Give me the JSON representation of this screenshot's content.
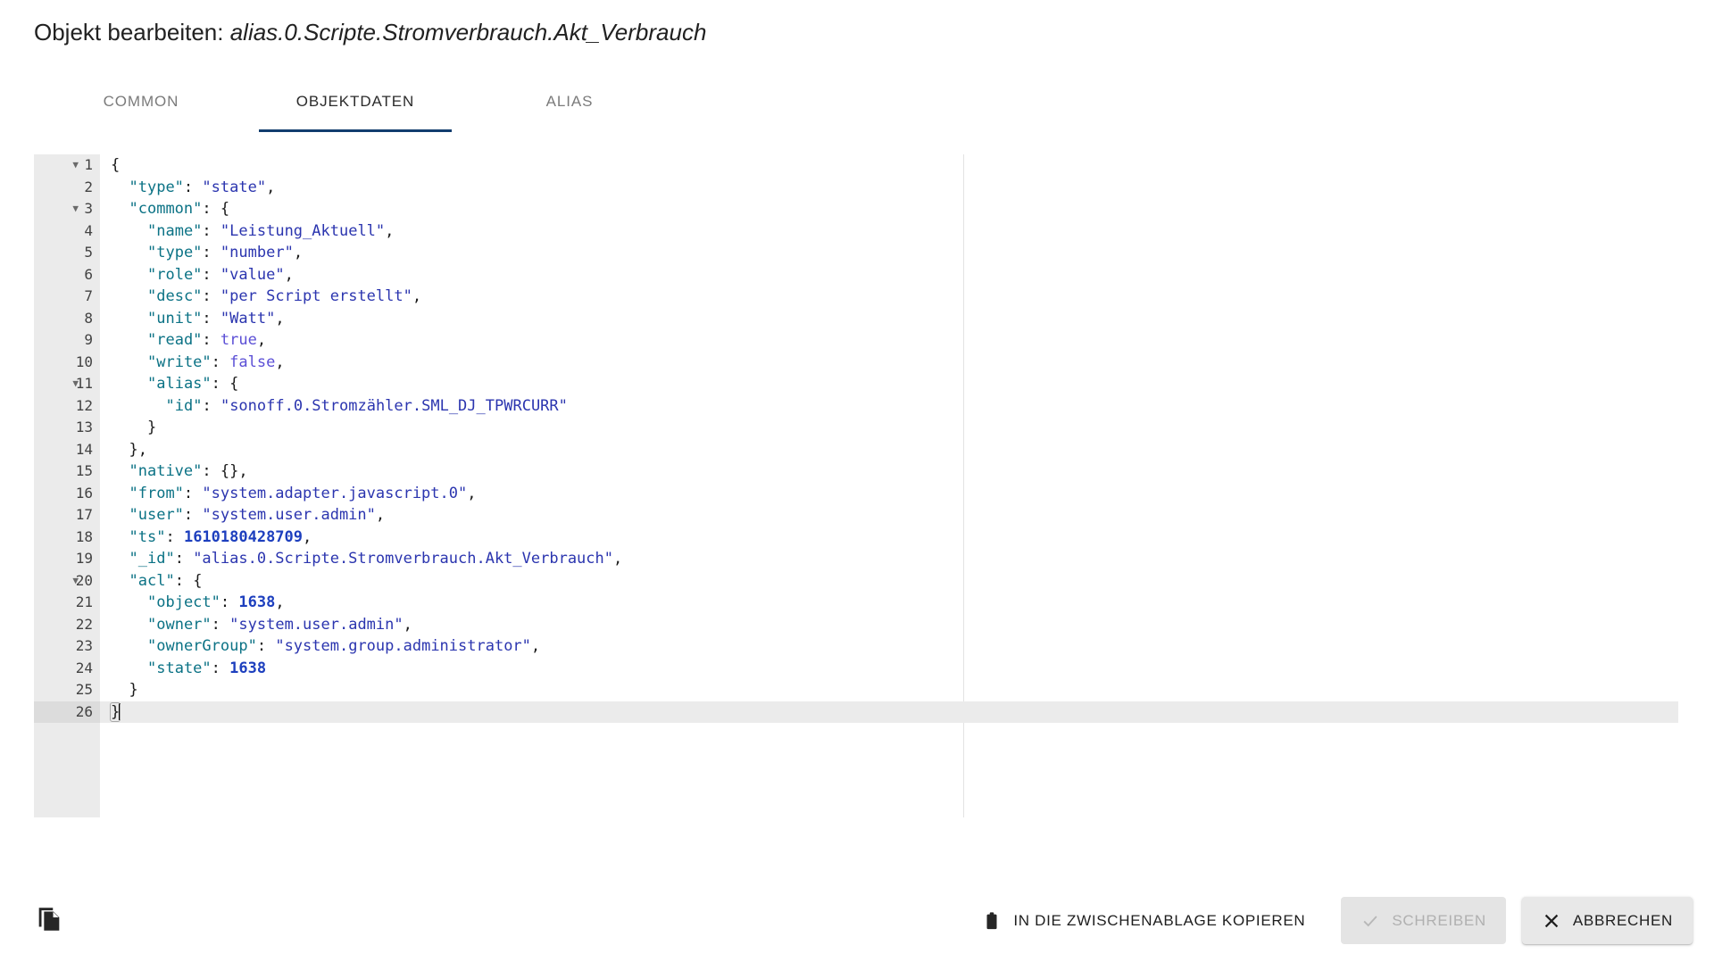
{
  "dialog": {
    "title_prefix": "Objekt bearbeiten:",
    "object_path": "alias.0.Scripte.Stromverbrauch.Akt_Verbrauch"
  },
  "tabs": [
    {
      "label": "COMMON",
      "active": false,
      "name": "tab-common"
    },
    {
      "label": "OBJEKTDATEN",
      "active": true,
      "name": "tab-objektdaten"
    },
    {
      "label": "ALIAS",
      "active": false,
      "name": "tab-alias"
    }
  ],
  "editor": {
    "active_line": 26,
    "total_lines": 26,
    "fold_lines": [
      1,
      3,
      11,
      20
    ],
    "lines": [
      {
        "n": 1,
        "text": "{"
      },
      {
        "n": 2,
        "text": "  \"type\": \"state\","
      },
      {
        "n": 3,
        "text": "  \"common\": {"
      },
      {
        "n": 4,
        "text": "    \"name\": \"Leistung_Aktuell\","
      },
      {
        "n": 5,
        "text": "    \"type\": \"number\","
      },
      {
        "n": 6,
        "text": "    \"role\": \"value\","
      },
      {
        "n": 7,
        "text": "    \"desc\": \"per Script erstellt\","
      },
      {
        "n": 8,
        "text": "    \"unit\": \"Watt\","
      },
      {
        "n": 9,
        "text": "    \"read\": true,"
      },
      {
        "n": 10,
        "text": "    \"write\": false,"
      },
      {
        "n": 11,
        "text": "    \"alias\": {"
      },
      {
        "n": 12,
        "text": "      \"id\": \"sonoff.0.Stromzähler.SML_DJ_TPWRCURR\""
      },
      {
        "n": 13,
        "text": "    }"
      },
      {
        "n": 14,
        "text": "  },"
      },
      {
        "n": 15,
        "text": "  \"native\": {},"
      },
      {
        "n": 16,
        "text": "  \"from\": \"system.adapter.javascript.0\","
      },
      {
        "n": 17,
        "text": "  \"user\": \"system.user.admin\","
      },
      {
        "n": 18,
        "text": "  \"ts\": 1610180428709,"
      },
      {
        "n": 19,
        "text": "  \"_id\": \"alias.0.Scripte.Stromverbrauch.Akt_Verbrauch\","
      },
      {
        "n": 20,
        "text": "  \"acl\": {"
      },
      {
        "n": 21,
        "text": "    \"object\": 1638,"
      },
      {
        "n": 22,
        "text": "    \"owner\": \"system.user.admin\","
      },
      {
        "n": 23,
        "text": "    \"ownerGroup\": \"system.group.administrator\","
      },
      {
        "n": 24,
        "text": "    \"state\": 1638"
      },
      {
        "n": 25,
        "text": "  }"
      },
      {
        "n": 26,
        "text": "}"
      }
    ]
  },
  "footer": {
    "duplicate_icon": "copy-documents-icon",
    "buttons": [
      {
        "name": "copy-to-clipboard-button",
        "label": "IN DIE ZWISCHENABLAGE KOPIEREN",
        "icon": "clipboard-icon",
        "style": "flat",
        "disabled": false
      },
      {
        "name": "write-button",
        "label": "SCHREIBEN",
        "icon": "check-icon",
        "style": "disabled",
        "disabled": true
      },
      {
        "name": "cancel-button",
        "label": "ABBRECHEN",
        "icon": "close-icon",
        "style": "raised",
        "disabled": false
      }
    ]
  },
  "colors": {
    "tab_indicator": "#123d6e",
    "gutter_bg": "#ebebeb",
    "active_line_bg": "#ebebeb",
    "active_gutter_bg": "#dcdcdc",
    "json_key": "#0b7285",
    "json_string": "#2b35af",
    "json_number": "#1d3fbe",
    "json_boolean": "#5b4fd6",
    "ruler": "#e3e3e3"
  }
}
